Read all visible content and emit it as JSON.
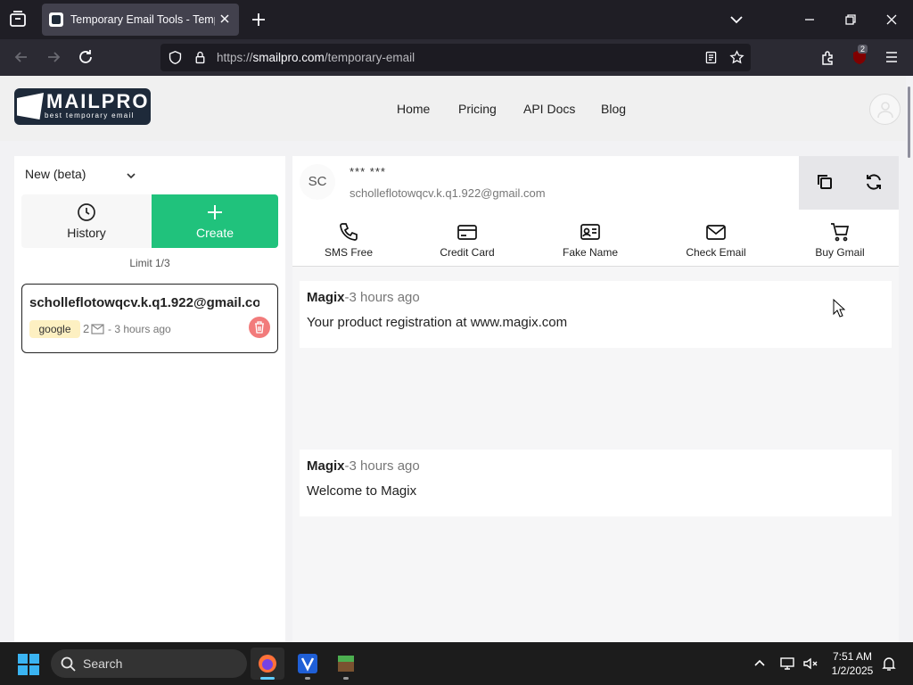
{
  "browser": {
    "tab_title": "Temporary Email Tools - Temporary Email",
    "url_prefix": "https://",
    "url_domain": "smailpro.com",
    "url_path": "/temporary-email",
    "extension_badge": "2"
  },
  "site": {
    "logo_name": "MAILPRO",
    "logo_tagline": "best temporary email",
    "nav": [
      "Home",
      "Pricing",
      "API Docs",
      "Blog"
    ]
  },
  "left_panel": {
    "mode_select": "New (beta)",
    "history_label": "History",
    "create_label": "Create",
    "limit_text": "Limit 1/3",
    "email_card": {
      "email": "scholleflotowqcv.k.q1.922@gmail.com",
      "tag": "google",
      "count": "2",
      "time": "- 3 hours ago"
    }
  },
  "inbox": {
    "initials": "SC",
    "masked_name": "*** ***",
    "address": "scholleflotowqcv.k.q1.922@gmail.com",
    "tools": [
      "SMS Free",
      "Credit Card",
      "Fake Name",
      "Check Email",
      "Buy Gmail"
    ],
    "messages": [
      {
        "sender": "Magix",
        "time": "-3 hours ago",
        "subject": "Your product registration at www.magix.com"
      },
      {
        "sender": "Magix",
        "time": "-3 hours ago",
        "subject": "Welcome to Magix"
      }
    ]
  },
  "taskbar": {
    "search_label": "Search",
    "time": "7:51 AM",
    "date": "1/2/2025"
  },
  "colors": {
    "accent_green": "#20c27c",
    "delete_red": "#f27b7b",
    "tag_yellow": "#fdf0c2",
    "browser_dark": "#1f1e25"
  }
}
